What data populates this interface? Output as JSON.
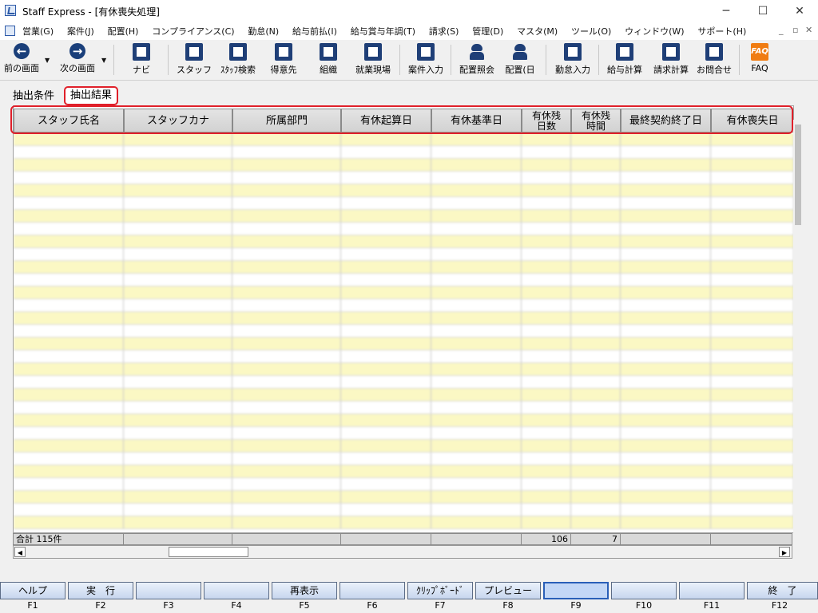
{
  "window": {
    "title": "Staff Express - [有休喪失処理]",
    "minimize": "─",
    "maximize": "☐",
    "close": "✕"
  },
  "menu": {
    "items": [
      "営業(G)",
      "案件(J)",
      "配置(H)",
      "コンプライアンス(C)",
      "勤怠(N)",
      "給与前払(I)",
      "給与賞与年調(T)",
      "請求(S)",
      "管理(D)",
      "マスタ(M)",
      "ツール(O)",
      "ウィンドウ(W)",
      "サポート(H)"
    ],
    "mdi_min": "_",
    "mdi_restore": "▫",
    "mdi_close": "✕"
  },
  "toolbar": {
    "back": "前の画面",
    "forward": "次の画面",
    "navi": "ナビ",
    "staff": "スタッフ",
    "staff_search": "ｽﾀｯﾌ検索",
    "client": "得意先",
    "org": "組織",
    "worksite": "就業現場",
    "case_input": "案件入力",
    "placement_inquiry": "配置照会",
    "placement_day": "配置(日",
    "attendance_input": "勤怠入力",
    "payroll_calc": "給与計算",
    "billing_calc": "請求計算",
    "contact": "お問合せ",
    "faq": "FAQ",
    "faq_icon": "FAQ"
  },
  "tabs": {
    "conditions": "抽出条件",
    "results": "抽出結果"
  },
  "grid": {
    "columns": [
      "スタッフ氏名",
      "スタッフカナ",
      "所属部門",
      "有休起算日",
      "有休基準日",
      "有休残\n日数",
      "有休残\n時間",
      "最終契約終了日",
      "有休喪失日"
    ],
    "columns_line1": [
      "スタッフ氏名",
      "スタッフカナ",
      "所属部門",
      "有休起算日",
      "有休基準日",
      "有休残",
      "有休残",
      "最終契約終了日",
      "有休喪失日"
    ],
    "columns_line2": [
      "",
      "",
      "",
      "",
      "",
      "日数",
      "時間",
      "",
      ""
    ],
    "footer": {
      "total_label": "合計 115件",
      "days_total": "106",
      "hours_total": "7"
    }
  },
  "fkeys": [
    {
      "label": "ヘルプ",
      "key": "F1"
    },
    {
      "label": "実　行",
      "key": "F2"
    },
    {
      "label": "",
      "key": "F3"
    },
    {
      "label": "",
      "key": "F4"
    },
    {
      "label": "再表示",
      "key": "F5"
    },
    {
      "label": "",
      "key": "F6"
    },
    {
      "label": "ｸﾘｯﾌﾟﾎﾞｰﾄﾞ",
      "key": "F7"
    },
    {
      "label": "プレビュー",
      "key": "F8"
    },
    {
      "label": "",
      "key": "F9"
    },
    {
      "label": "",
      "key": "F10"
    },
    {
      "label": "",
      "key": "F11"
    },
    {
      "label": "終　了",
      "key": "F12"
    }
  ]
}
